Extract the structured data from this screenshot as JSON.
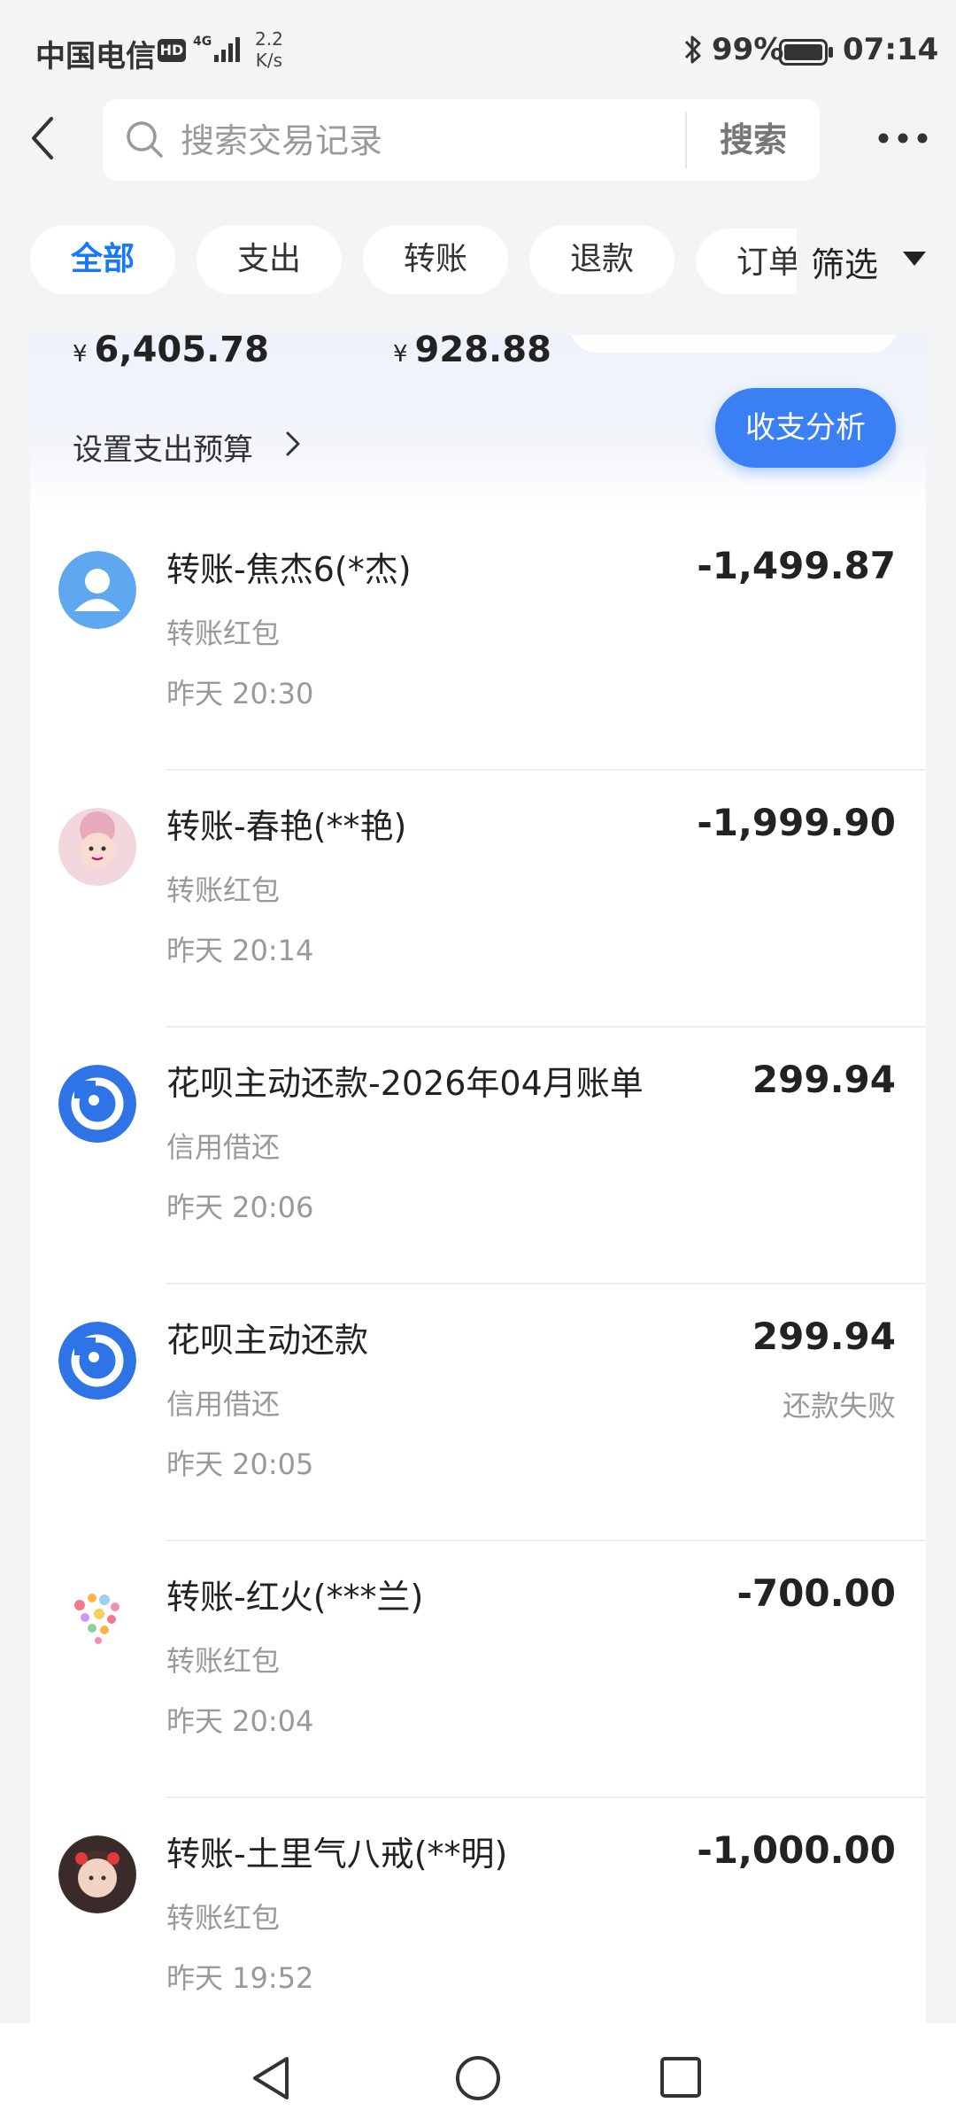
{
  "status_bar": {
    "carrier": "中国电信",
    "hd": "HD",
    "network": "4G",
    "speed_value": "2.2",
    "speed_unit": "K/s",
    "battery": "99%",
    "time": "07:14"
  },
  "search": {
    "placeholder": "搜索交易记录",
    "button": "搜索"
  },
  "tabs": [
    "全部",
    "支出",
    "转账",
    "退款",
    "订单"
  ],
  "filter": {
    "label": "筛选"
  },
  "summary": {
    "currency": "¥",
    "expense": "6,405.78",
    "income": "928.88",
    "budget_link": "设置支出预算",
    "analysis_button": "收支分析"
  },
  "transactions": [
    {
      "title": "转账-焦杰6(*杰)",
      "category": "转账红包",
      "time": "昨天 20:30",
      "amount": "-1,499.87",
      "status": "",
      "avatar": "default-person-avatar"
    },
    {
      "title": "转账-春艳(**艳)",
      "category": "转账红包",
      "time": "昨天 20:14",
      "amount": "-1,999.90",
      "status": "",
      "avatar": "baby-photo-avatar"
    },
    {
      "title": "花呗主动还款-2026年04月账单",
      "category": "信用借还",
      "time": "昨天 20:06",
      "amount": "299.94",
      "status": "",
      "avatar": "huabei-logo"
    },
    {
      "title": "花呗主动还款",
      "category": "信用借还",
      "time": "昨天 20:05",
      "amount": "299.94",
      "status": "还款失败",
      "avatar": "huabei-logo"
    },
    {
      "title": "转账-红火(***兰)",
      "category": "转账红包",
      "time": "昨天 20:04",
      "amount": "-700.00",
      "status": "",
      "avatar": "heart-candy-avatar"
    },
    {
      "title": "转账-土里气八戒(**明)",
      "category": "转账红包",
      "time": "昨天 19:52",
      "amount": "-1,000.00",
      "status": "",
      "avatar": "girl-photo-avatar"
    }
  ],
  "colors": {
    "accent": "#1677ff",
    "button": "#3a7ff3",
    "background": "#f3f4f6"
  }
}
